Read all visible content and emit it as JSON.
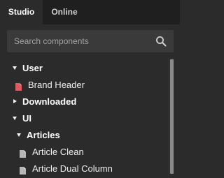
{
  "tabs": [
    {
      "label": "Studio",
      "active": true
    },
    {
      "label": "Online",
      "active": false
    }
  ],
  "search": {
    "placeholder": "Search components",
    "value": "",
    "icon": "search-icon"
  },
  "tree": [
    {
      "label": "User",
      "kind": "folder",
      "expanded": true,
      "level": 0
    },
    {
      "label": "Brand Header",
      "kind": "component",
      "icon": "red-document-icon",
      "level": 1
    },
    {
      "label": "Downloaded",
      "kind": "folder",
      "expanded": false,
      "level": 0
    },
    {
      "label": "UI",
      "kind": "folder",
      "expanded": true,
      "level": 0
    },
    {
      "label": "Articles",
      "kind": "folder",
      "expanded": true,
      "level": 1
    },
    {
      "label": "Article Clean",
      "kind": "component",
      "icon": "document-icon",
      "level": 2
    },
    {
      "label": "Article Dual Column",
      "kind": "component",
      "icon": "document-icon",
      "level": 2
    }
  ],
  "colors": {
    "background": "#2b2b2b",
    "tabbar": "#1f1f1f",
    "search_field": "#3a3a3a",
    "brand_icon": "#e05a60",
    "doc_icon": "#b8b8b8",
    "scroll_thumb": "#8a8a8a"
  }
}
